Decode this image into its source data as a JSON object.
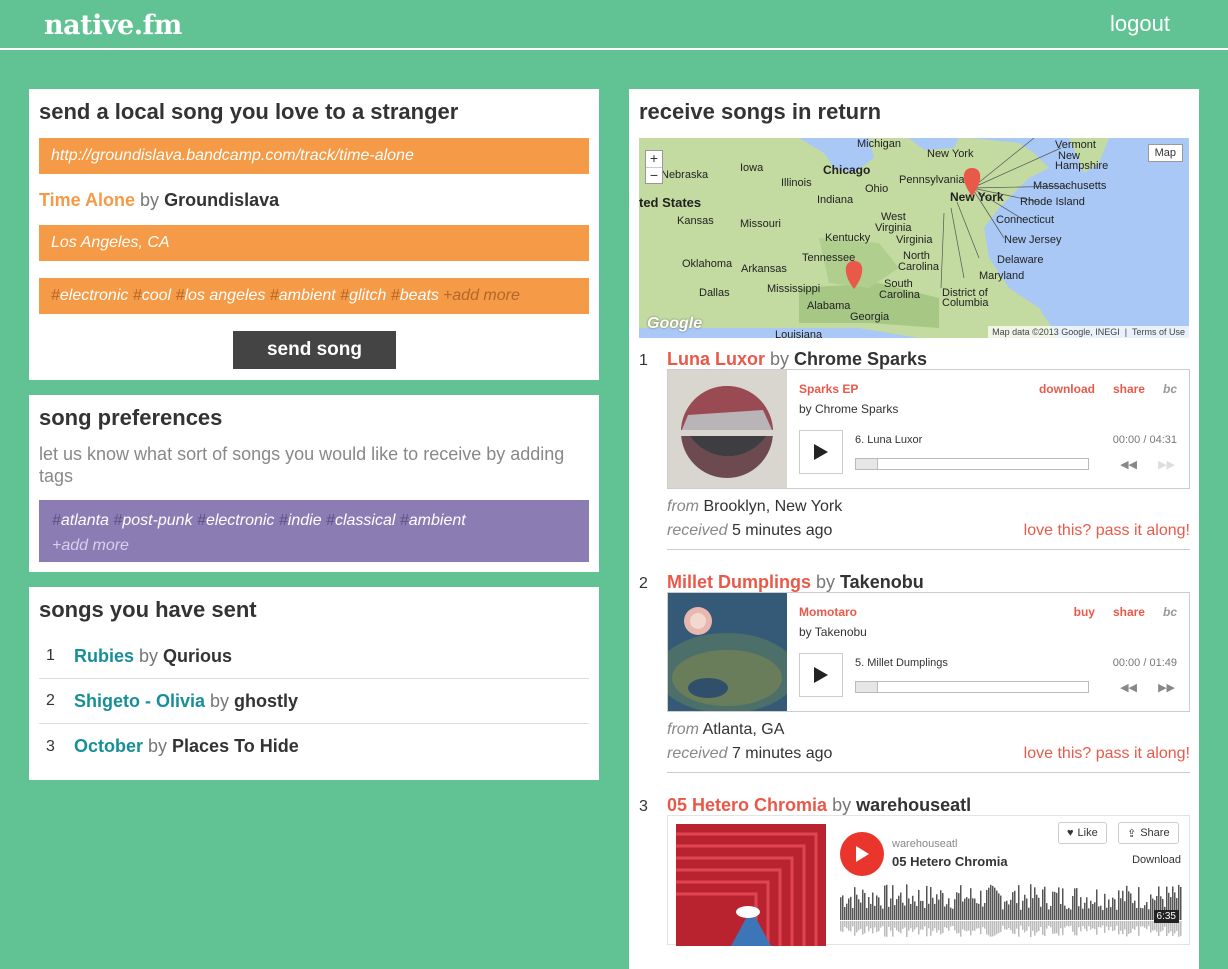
{
  "header": {
    "logo": "native.fm",
    "logout": "logout"
  },
  "send": {
    "title": "send a local song you love to a stranger",
    "url": "http://groundislava.bandcamp.com/track/time-alone",
    "song_title": "Time Alone",
    "by": "by",
    "artist": "Groundislava",
    "location": "Los Angeles, CA",
    "tags": [
      "electronic",
      "cool",
      "los angeles",
      "ambient",
      "glitch",
      "beats"
    ],
    "add_more": "+add more",
    "button": "send song"
  },
  "prefs": {
    "title": "song preferences",
    "desc": "let us know what sort of songs you would like to receive by adding tags",
    "tags": [
      "atlanta",
      "post-punk",
      "electronic",
      "indie",
      "classical",
      "ambient"
    ],
    "add_more": "+add more"
  },
  "sent": {
    "title": "songs you have sent",
    "items": [
      {
        "num": "1",
        "title": "Rubies",
        "by": "by",
        "artist": "Qurious"
      },
      {
        "num": "2",
        "title": "Shigeto - Olivia",
        "by": "by",
        "artist": "ghostly"
      },
      {
        "num": "3",
        "title": "October",
        "by": "by",
        "artist": "Places To Hide"
      }
    ]
  },
  "receive": {
    "title": "receive songs in return",
    "map": {
      "zoom_in": "+",
      "zoom_out": "−",
      "type_btn": "Map",
      "credit_data": "Map data ©2013 Google, INEGI",
      "credit_terms": "Terms of Use",
      "google": "Google",
      "labels": [
        "Michigan",
        "New York",
        "Vermont",
        "New",
        "Hampshire",
        "Nebraska",
        "Iowa",
        "Chicago",
        "Illinois",
        "Ohio",
        "Pennsylvania",
        "Massachusetts",
        "New York",
        "Rhode Island",
        "ted States",
        "Indiana",
        "Kansas",
        "Missouri",
        "West",
        "Virginia",
        "Connecticut",
        "Kentucky",
        "Virginia",
        "New Jersey",
        "Oklahoma",
        "Arkansas",
        "Tennessee",
        "North",
        "Carolina",
        "Delaware",
        "Dallas",
        "Mississippi",
        "South",
        "Carolina",
        "Maryland",
        "Alabama",
        "Georgia",
        "District of",
        "Columbia",
        "Louisiana"
      ]
    },
    "tracks": [
      {
        "num": "1",
        "title": "Luna Luxor",
        "by": "by",
        "artist": "Chrome Sparks",
        "album": "Sparks EP",
        "album_artist": "by Chrome Sparks",
        "action1": "download",
        "action2": "share",
        "bc": "bc",
        "track_name": "6.  Luna Luxor",
        "time": "00:00 / 04:31",
        "from_label": "from",
        "from": "Brooklyn, New York",
        "received_label": "received",
        "received": "5 minutes ago",
        "love": "love this? pass it along!"
      },
      {
        "num": "2",
        "title": "Millet Dumplings",
        "by": "by",
        "artist": "Takenobu",
        "album": "Momotaro",
        "album_artist": "by Takenobu",
        "action1": "buy",
        "action2": "share",
        "bc": "bc",
        "track_name": "5.  Millet Dumplings",
        "time": "00:00 / 01:49",
        "from_label": "from",
        "from": "Atlanta, GA",
        "received_label": "received",
        "received": "7 minutes ago",
        "love": "love this? pass it along!"
      },
      {
        "num": "3",
        "title": "05 Hetero Chromia",
        "by": "by",
        "artist": "warehouseatl",
        "sc_user": "warehouseatl",
        "sc_title": "05 Hetero Chromia",
        "like": "Like",
        "share": "Share",
        "download": "Download",
        "duration": "6:35"
      }
    ]
  },
  "colors": {
    "background": "#61c393",
    "orange": "#f59a46",
    "purple": "#8c7cb4",
    "teal_link": "#178f98",
    "red_link": "#e9594a"
  }
}
